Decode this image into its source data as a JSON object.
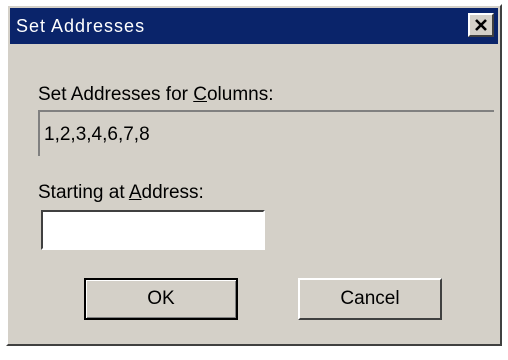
{
  "window": {
    "title": "Set Addresses",
    "close_icon": "close-icon"
  },
  "columns": {
    "label_prefix": "Set Addresses for ",
    "label_mnemonic": "C",
    "label_rest": "olumns:",
    "value": "1,2,3,4,6,7,8"
  },
  "address": {
    "label_prefix": "Starting at ",
    "label_mnemonic": "A",
    "label_rest": "ddress:",
    "value": "",
    "placeholder": ""
  },
  "buttons": {
    "ok_label": "OK",
    "cancel_label": "Cancel"
  },
  "colors": {
    "title_bar": "#0a246a",
    "dialog_face": "#d4d0c8"
  }
}
